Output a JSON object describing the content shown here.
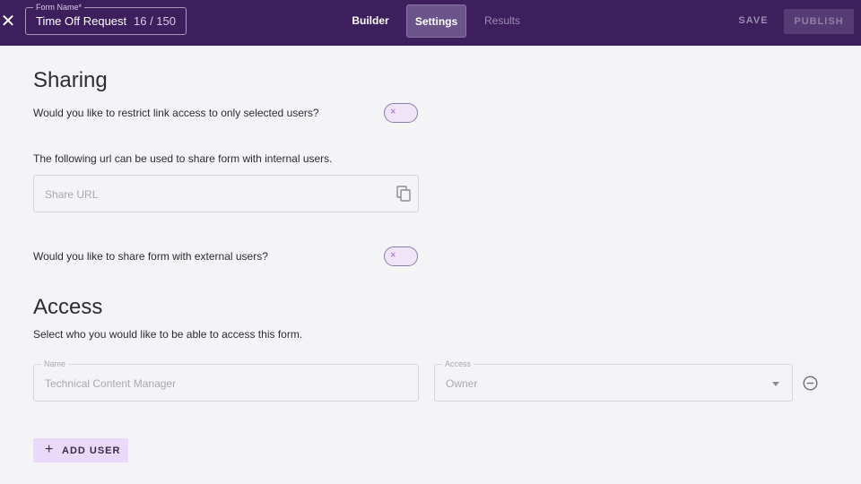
{
  "header": {
    "close_icon": "close-icon",
    "form_name_label": "Form Name",
    "form_name_required_mark": "*",
    "form_name_value": "Time Off Request",
    "form_name_count": "16 / 150",
    "tabs": [
      {
        "label": "Builder",
        "active": false
      },
      {
        "label": "Settings",
        "active": true
      },
      {
        "label": "Results",
        "active": false
      }
    ],
    "save_label": "SAVE",
    "publish_label": "PUBLISH"
  },
  "sharing": {
    "title": "Sharing",
    "restrict_question": "Would you like to restrict link access to only selected users?",
    "restrict_toggle_icon": "×",
    "internal_text": "The following url can be used to share form with internal users.",
    "share_url_placeholder": "Share URL",
    "copy_icon": "copy-icon",
    "external_question": "Would you like to share form with external users?",
    "external_toggle_icon": "×"
  },
  "access": {
    "title": "Access",
    "description": "Select who you would like to be able to access this form.",
    "rows": [
      {
        "name_label": "Name",
        "name_value": "Technical Content Manager",
        "access_label": "Access",
        "access_value": "Owner"
      }
    ],
    "add_user_icon": "+",
    "add_user_label": "ADD USER"
  },
  "colors": {
    "header_bg": "#3d1f5e",
    "active_tab_bg": "#6b548a",
    "add_user_bg": "#ead9f8",
    "toggle_x": "#b15ccd"
  }
}
